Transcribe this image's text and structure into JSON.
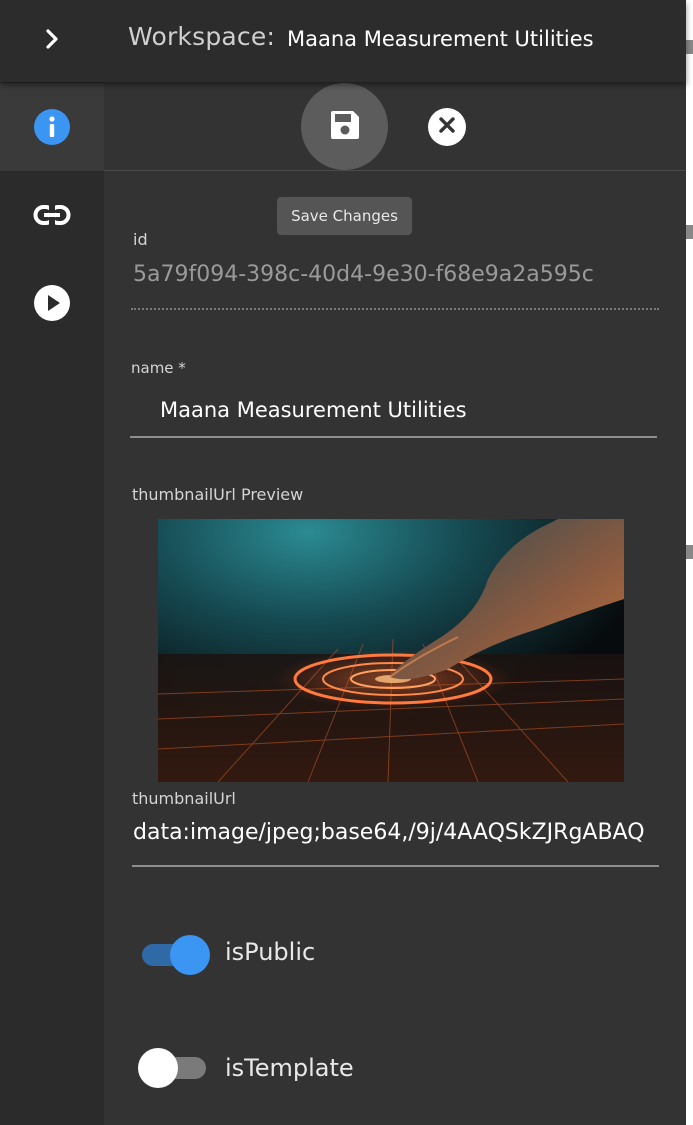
{
  "header": {
    "workspace_label": "Workspace:",
    "workspace_name": "Maana Measurement Utilities"
  },
  "rail": {
    "items": [
      {
        "icon": "info-icon",
        "active": true
      },
      {
        "icon": "link-icon",
        "active": false
      },
      {
        "icon": "play-icon",
        "active": false
      }
    ]
  },
  "toolbar": {
    "save_tooltip": "Save Changes"
  },
  "form": {
    "id_label": "id",
    "id_value": "5a79f094-398c-40d4-9e30-f68e9a2a595c",
    "name_label": "name *",
    "name_value": "Maana Measurement Utilities",
    "thumbnail_preview_label": "thumbnailUrl Preview",
    "thumbnail_url_label": "thumbnailUrl",
    "thumbnail_url_value": "data:image/jpeg;base64,/9j/4AAQSkZJRgABAQ",
    "is_public_label": "isPublic",
    "is_public": true,
    "is_template_label": "isTemplate",
    "is_template": false
  },
  "colors": {
    "accent": "#3b95f2",
    "background": "#333333",
    "rail": "#2b2b2b"
  }
}
